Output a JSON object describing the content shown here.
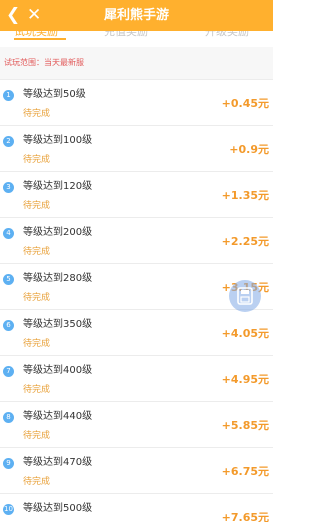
{
  "header": {
    "title": "犀利熊手游",
    "back_icon": "chevron-left-icon",
    "close_icon": "close-icon",
    "color": "#FFB02E"
  },
  "tabs": [
    {
      "label": "试玩奖励",
      "active": true
    },
    {
      "label": "充值奖励",
      "active": false
    },
    {
      "label": "升级奖励",
      "active": false
    }
  ],
  "scope_text": "试玩范围：当天最新服",
  "tasks": [
    {
      "num": "1",
      "level": "等级达到50级",
      "status": "待完成",
      "reward": "+0.45元"
    },
    {
      "num": "2",
      "level": "等级达到100级",
      "status": "待完成",
      "reward": "+0.9元"
    },
    {
      "num": "3",
      "level": "等级达到120级",
      "status": "待完成",
      "reward": "+1.35元"
    },
    {
      "num": "4",
      "level": "等级达到200级",
      "status": "待完成",
      "reward": "+2.25元"
    },
    {
      "num": "5",
      "level": "等级达到280级",
      "status": "待完成",
      "reward": "+3.15元"
    },
    {
      "num": "6",
      "level": "等级达到350级",
      "status": "待完成",
      "reward": "+4.05元"
    },
    {
      "num": "7",
      "level": "等级达到400级",
      "status": "待完成",
      "reward": "+4.95元"
    },
    {
      "num": "8",
      "level": "等级达到440级",
      "status": "待完成",
      "reward": "+5.85元"
    },
    {
      "num": "9",
      "level": "等级达到470级",
      "status": "待完成",
      "reward": "+6.75元"
    },
    {
      "num": "10",
      "level": "等级达到500级",
      "status": "",
      "reward": "+7.65元"
    }
  ],
  "floating_button_icon": "save-icon"
}
